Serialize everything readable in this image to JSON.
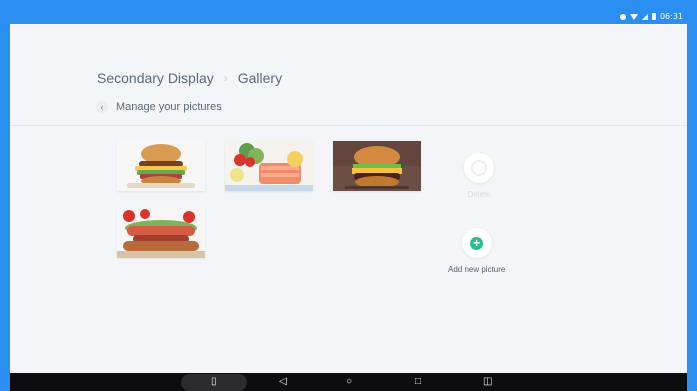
{
  "status": {
    "time": "06:31"
  },
  "breadcrumb": {
    "parent": "Secondary Display",
    "current": "Gallery"
  },
  "subnav": {
    "title": "Manage your pictures"
  },
  "gallery": [
    {
      "name": "burger-with-egg-thumbnail",
      "description": "Stacked burger with egg and lettuce"
    },
    {
      "name": "salmon-plate-thumbnail",
      "description": "Salmon steak with salad and lemon"
    },
    {
      "name": "cheeseburger-thumbnail",
      "description": "Cheeseburger on dark background"
    },
    {
      "name": "hotdog-thumbnail",
      "description": "Sausage sandwich with tomatoes"
    }
  ],
  "actions": {
    "delete_label": "Delete",
    "add_label": "Add new picture"
  },
  "colors": {
    "accent": "#2b8ff2",
    "add": "#27c08a",
    "background": "#f4f5f9",
    "navbar": "#0d0d0f"
  },
  "icons": [
    "back-icon",
    "delete-icon",
    "add-icon",
    "menu-icon",
    "back-nav-icon",
    "home-icon",
    "recents-icon",
    "rotate-icon"
  ]
}
